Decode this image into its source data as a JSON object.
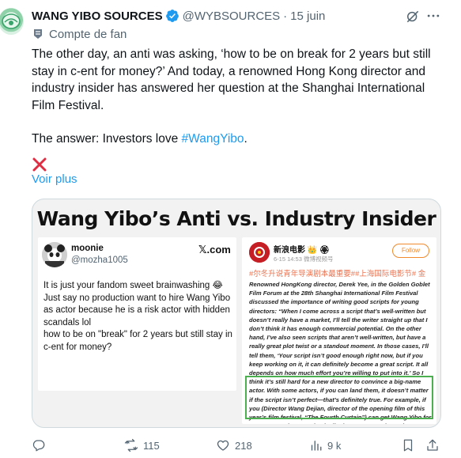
{
  "tweet": {
    "author_name": "WANG YIBO SOURCES",
    "handle": "@WYBSOURCES",
    "separator": "·",
    "time": "15 juin",
    "fan_label": "Compte de fan",
    "text_p1": "The other day, an anti was asking, ‘how to be on break for 2 years but still stay in c-ent for money?’ And today, a renowned Hong Kong director and industry insider has answered her question at the Shanghai International Film Festival.",
    "text_p2_prefix": "The answer: Investors love ",
    "hashtag": "#WangYibo",
    "text_p2_suffix": ".",
    "emoji_cross": "❌",
    "show_more": "Voir plus"
  },
  "media": {
    "title": "Wang Yibo’s Anti vs. Industry Insider",
    "left_post": {
      "name": "moonie",
      "handle": "@mozha1005",
      "platform": "𝕏.com",
      "body_l1": "It is just your fandom sweet brainwashing 😂",
      "body_l2": "Just say no production want to hire  Wang Yibo as actor because he is a risk actor with hidden scandals lol",
      "body_l3": "how to be on \"break\" for 2 years but still stay in c-ent for money?"
    },
    "right_post": {
      "name": "新浪电影 👑 🏵",
      "meta": "6-15 14:53  微博视频号",
      "follow_label": "Follow",
      "tags": "#尔冬升说青年导演剧本最重要##上海国际电影节# 金",
      "body": "Renowned HongKong director, Derek Yee, in the Golden Goblet Film Forum at the 28th Shanghai International Film Festival discussed the importance of writing good scripts for young directors: “When I come across a script that’s well-written but doesn’t really have a market, I’ll tell the writer straight up that I don’t think it has enough commercial potential. On the other hand, I’ve also seen scripts that aren’t well-written, but have a really great plot twist or a standout moment. In those cases, I’ll tell them, ‘Your script isn’t good enough right now, but if you keep working on it, it can definitely become a great script. It all depends on how much effort you’re willing to put into it.’ So I think it’s still hard for a new director to convince a big-name actor. With some actors, if you can land them, it doesn’t matter if the script isn’t perfect—that’s definitely true. For example, if you (Director Wang Dejian, director of the opening film of this year’s film festival, “The Fourth Curtain”) can get Wang Yibo for your next project, you basically don’t even need to write a script; you can start shooting right away. That’s a very real issue.”"
    }
  },
  "actions": {
    "retweets": "115",
    "likes": "218",
    "views": "9 k"
  },
  "colors": {
    "accent": "#1d9bf0",
    "secondary_text": "#536471",
    "verified": "#1d9bf0",
    "highlight": "#4caf50"
  }
}
